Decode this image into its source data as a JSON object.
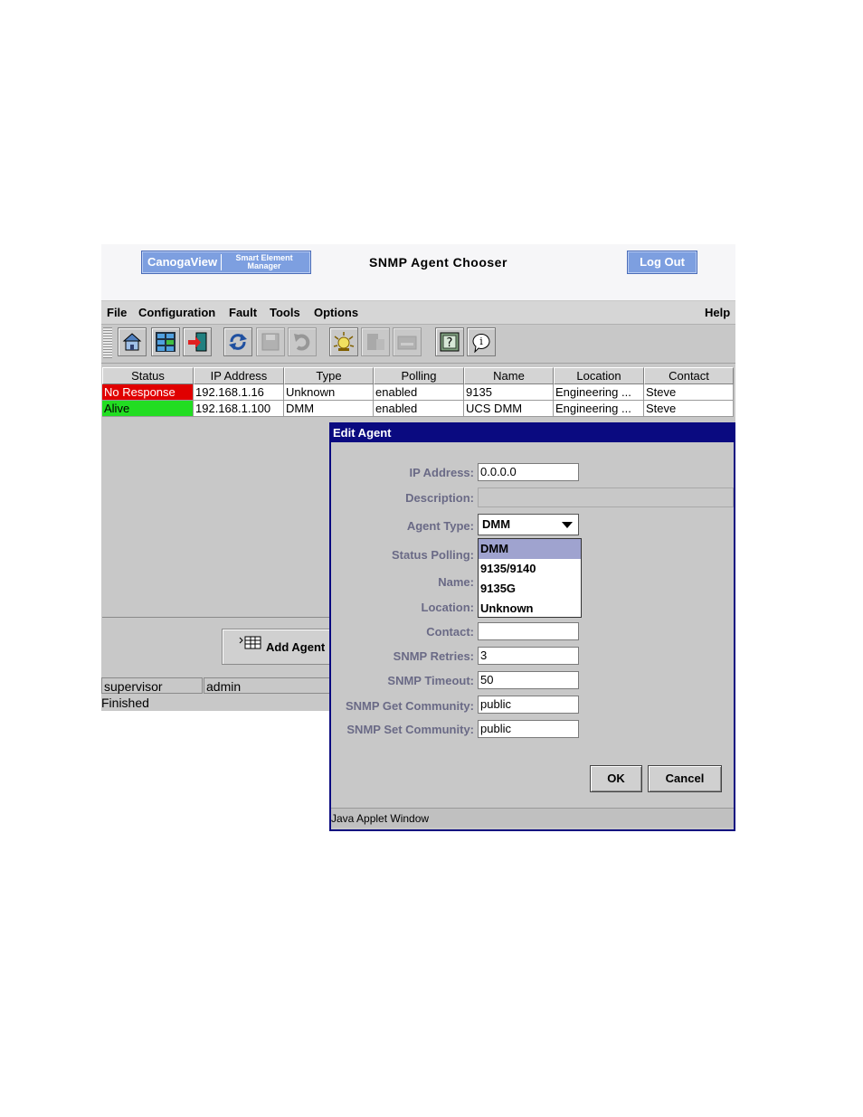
{
  "header": {
    "logo_main": "CanogaView",
    "logo_sub_1": "Smart Element",
    "logo_sub_2": "Manager",
    "title": "SNMP Agent Chooser",
    "logout_label": "Log Out"
  },
  "menubar": {
    "items": [
      "File",
      "Configuration",
      "Fault",
      "Tools",
      "Options"
    ],
    "help": "Help"
  },
  "toolbar": {
    "buttons": [
      "home-icon",
      "grid-icon",
      "exit-icon",
      "refresh-icon",
      "save-icon",
      "undo-icon",
      "alarm-icon",
      "device-icon",
      "module-icon",
      "help-icon",
      "info-icon"
    ]
  },
  "table": {
    "columns": [
      "Status",
      "IP Address",
      "Type",
      "Polling",
      "Name",
      "Location",
      "Contact"
    ],
    "rows": [
      {
        "status": "No Response",
        "status_color": "#e00000",
        "ip": "192.168.1.16",
        "type": "Unknown",
        "polling": "enabled",
        "name": "9135",
        "location": "Engineering ...",
        "contact": "Steve"
      },
      {
        "status": "Alive",
        "status_color": "#22dd22",
        "ip": "192.168.1.100",
        "type": "DMM",
        "polling": "enabled",
        "name": "UCS DMM",
        "location": "Engineering ...",
        "contact": "Steve"
      }
    ]
  },
  "add_agent_label": "Add Agent",
  "statusbar": {
    "user": "supervisor",
    "role": "admin",
    "state": "Finished"
  },
  "dialog": {
    "title": "Edit Agent",
    "labels": {
      "ip": "IP Address:",
      "description": "Description:",
      "agent_type": "Agent Type:",
      "status_polling": "Status Polling:",
      "name": "Name:",
      "location": "Location:",
      "contact": "Contact:",
      "retries": "SNMP Retries:",
      "timeout": "SNMP Timeout:",
      "get_community": "SNMP Get Community:",
      "set_community": "SNMP Set Community:"
    },
    "values": {
      "ip": "0.0.0.0",
      "description": "",
      "agent_type": "DMM",
      "contact": "",
      "retries": "3",
      "timeout": "50",
      "get_community": "public",
      "set_community": "public"
    },
    "agent_type_options": [
      "DMM",
      "9135/9140",
      "9135G",
      "Unknown"
    ],
    "ok_label": "OK",
    "cancel_label": "Cancel",
    "footer": "Java Applet Window"
  }
}
